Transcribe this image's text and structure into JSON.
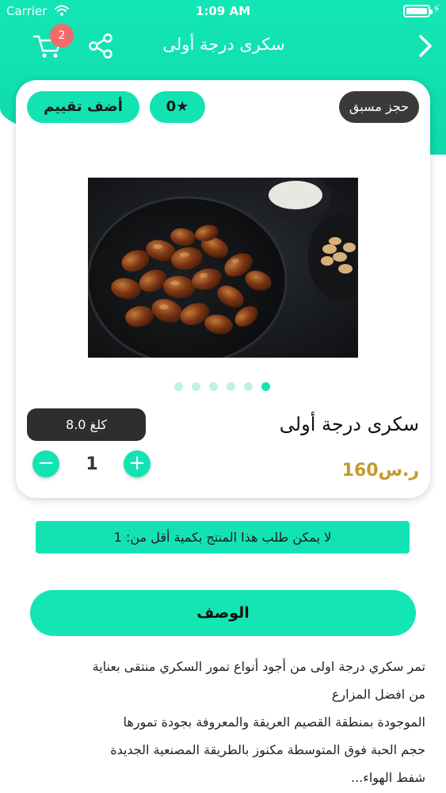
{
  "status_bar": {
    "carrier": "Carrier",
    "time": "1:09 AM"
  },
  "nav": {
    "title": "سكرى درجة أولى",
    "cart_count": "2",
    "icons": [
      "cart-icon",
      "share-icon",
      "chevron-right-icon"
    ]
  },
  "card": {
    "add_rating_label": "أضف تقييم",
    "rating_label": "0★",
    "preorder_label": "حجز مسبق",
    "image_dots": 6,
    "active_dot": 6,
    "weight_label": "8.0 كلغ",
    "product_name": "سكرى درجة أولى",
    "quantity": "1",
    "price": "160ر.س"
  },
  "min_qty_message": "لا يمكن طلب هذا المنتج بكمية أقل من: 1",
  "description": {
    "button_label": "الوصف",
    "lines": [
      "تمر سكري درجة اولى من أجود أنواع تمور السكري منتقى بعناية",
      "من افضل المزارع",
      "الموجودة بمنطقة القصيم العريقة والمعروفة بجودة تمورها",
      "حجم الحبة فوق المتوسطة مكنوز بالطريقة المصنعية الجديدة",
      "شفط الهواء..."
    ]
  },
  "colors": {
    "accent": "#13e3b3",
    "dark_pill": "#2e2e2e",
    "price": "#c29b2a",
    "badge": "#f26b6b"
  }
}
